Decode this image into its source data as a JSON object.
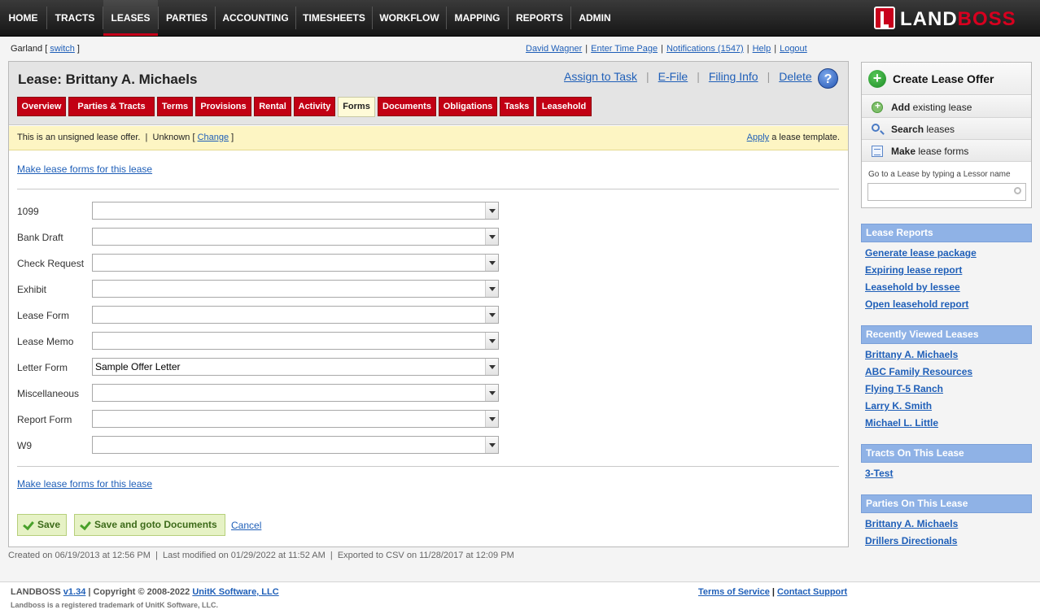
{
  "nav": {
    "items": [
      "HOME",
      "TRACTS",
      "LEASES",
      "PARTIES",
      "ACCOUNTING",
      "TIMESHEETS",
      "WORKFLOW",
      "MAPPING",
      "REPORTS",
      "ADMIN"
    ],
    "active": "LEASES",
    "logo_left": "LAND",
    "logo_right": "BOSS"
  },
  "userbar": {
    "location": "Garland",
    "switch_label": "switch",
    "user": "David Wagner",
    "time_page": "Enter Time Page",
    "notifications": "Notifications (1547)",
    "help": "Help",
    "logout": "Logout"
  },
  "lease": {
    "title": "Lease: Brittany A. Michaels",
    "actions": [
      "Assign to Task",
      "E-File",
      "Filing Info",
      "Delete"
    ],
    "help_icon_label": "?"
  },
  "tabs": {
    "items": [
      "Overview",
      "Parties & Tracts",
      "Terms",
      "Provisions",
      "Rental",
      "Activity",
      "Forms",
      "Documents",
      "Obligations",
      "Tasks",
      "Leasehold"
    ],
    "active": "Forms"
  },
  "notice": {
    "text": "This is an unsigned lease offer.  |  Unknown [ ",
    "change_link": "Change",
    "close_bracket": " ]",
    "apply_link": "Apply",
    "apply_suffix": " a lease template."
  },
  "forms": {
    "make_link": "Make lease forms for this lease",
    "rows": [
      {
        "label": "1099",
        "value": ""
      },
      {
        "label": "Bank Draft",
        "value": ""
      },
      {
        "label": "Check Request",
        "value": ""
      },
      {
        "label": "Exhibit",
        "value": ""
      },
      {
        "label": "Lease Form",
        "value": ""
      },
      {
        "label": "Lease Memo",
        "value": ""
      },
      {
        "label": "Letter Form",
        "value": "Sample Offer Letter"
      },
      {
        "label": "Miscellaneous",
        "value": ""
      },
      {
        "label": "Report Form",
        "value": ""
      },
      {
        "label": "W9",
        "value": ""
      }
    ],
    "save": "Save",
    "save_goto": "Save and goto Documents",
    "cancel": "Cancel"
  },
  "meta": {
    "line": "Created on 06/19/2013 at 12:56 PM  |  Last modified on 01/29/2022 at 11:52 AM  |  Exported to CSV on 11/28/2017 at 12:09 PM"
  },
  "sidebar": {
    "create_offer": "Create Lease Offer",
    "add_bold": "Add",
    "add_rest": " existing lease",
    "search_bold": "Search",
    "search_rest": " leases",
    "make_bold": "Make",
    "make_rest": " lease forms",
    "goto_label": "Go to a Lease by typing a Lessor name",
    "goto_value": "",
    "sections": [
      {
        "title": "Lease Reports",
        "links": [
          "Generate lease package",
          "Expiring lease report",
          "Leasehold by lessee",
          "Open leasehold report"
        ]
      },
      {
        "title": "Recently Viewed Leases",
        "links": [
          "Brittany A. Michaels",
          "ABC Family Resources",
          "Flying T-5 Ranch",
          "Larry K. Smith",
          "Michael L. Little"
        ]
      },
      {
        "title": "Tracts On This Lease",
        "links": [
          "3-Test"
        ]
      },
      {
        "title": "Parties On This Lease",
        "links": [
          "Brittany A. Michaels",
          "Drillers Directionals"
        ]
      }
    ]
  },
  "footer": {
    "brand": "LANDBOSS",
    "version": "v1.34",
    "copyright": " | Copyright © 2008-2022 ",
    "company": "UnitK Software, LLC",
    "trademark": "Landboss is a registered trademark of UnitK Software, LLC.",
    "terms": "Terms of Service",
    "support": "Contact Support"
  },
  "colors": {
    "tab_red": "#c20014",
    "side_head_blue": "#8fb2e6",
    "link_blue": "#1f5fb8",
    "notice_yellow": "#fdf5c3"
  }
}
